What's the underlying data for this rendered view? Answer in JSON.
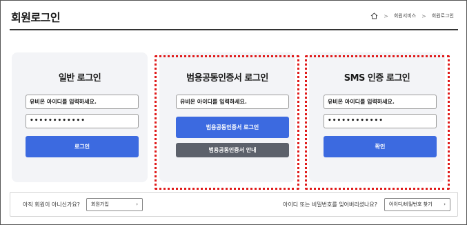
{
  "header": {
    "title": "회원로그인",
    "breadcrumb": [
      "회원서비스",
      "회원로그인"
    ],
    "breadcrumb_separator": ">"
  },
  "cards": [
    {
      "title": "일반 로그인",
      "id_placeholder": "유비온 아이디를 입력하세요.",
      "password_value": "••••••••••••",
      "submit_label": "로그인"
    },
    {
      "title": "범용공동인증서 로그인",
      "id_placeholder": "유비온 아이디를 입력하세요.",
      "submit_label": "범용공동인증서 로그인",
      "guide_label": "범용공동인증서 안내"
    },
    {
      "title": "SMS 인증 로그인",
      "id_placeholder": "유비온 아이디를 입력하세요.",
      "password_value": "••••••••••••",
      "submit_label": "확인"
    }
  ],
  "footer": {
    "not_member_text": "아직 회원이 아니신가요?",
    "join_label": "회원가입",
    "forgot_text": "아이디 또는 비밀번호를 잊어버리셨나요?",
    "find_label": "아이디/비밀번호 찾기",
    "chevron": "›"
  },
  "colors": {
    "primary": "#3c6ae0",
    "secondary": "#5c616b",
    "highlight": "#e01a1a",
    "card_bg": "#f3f4f7"
  }
}
